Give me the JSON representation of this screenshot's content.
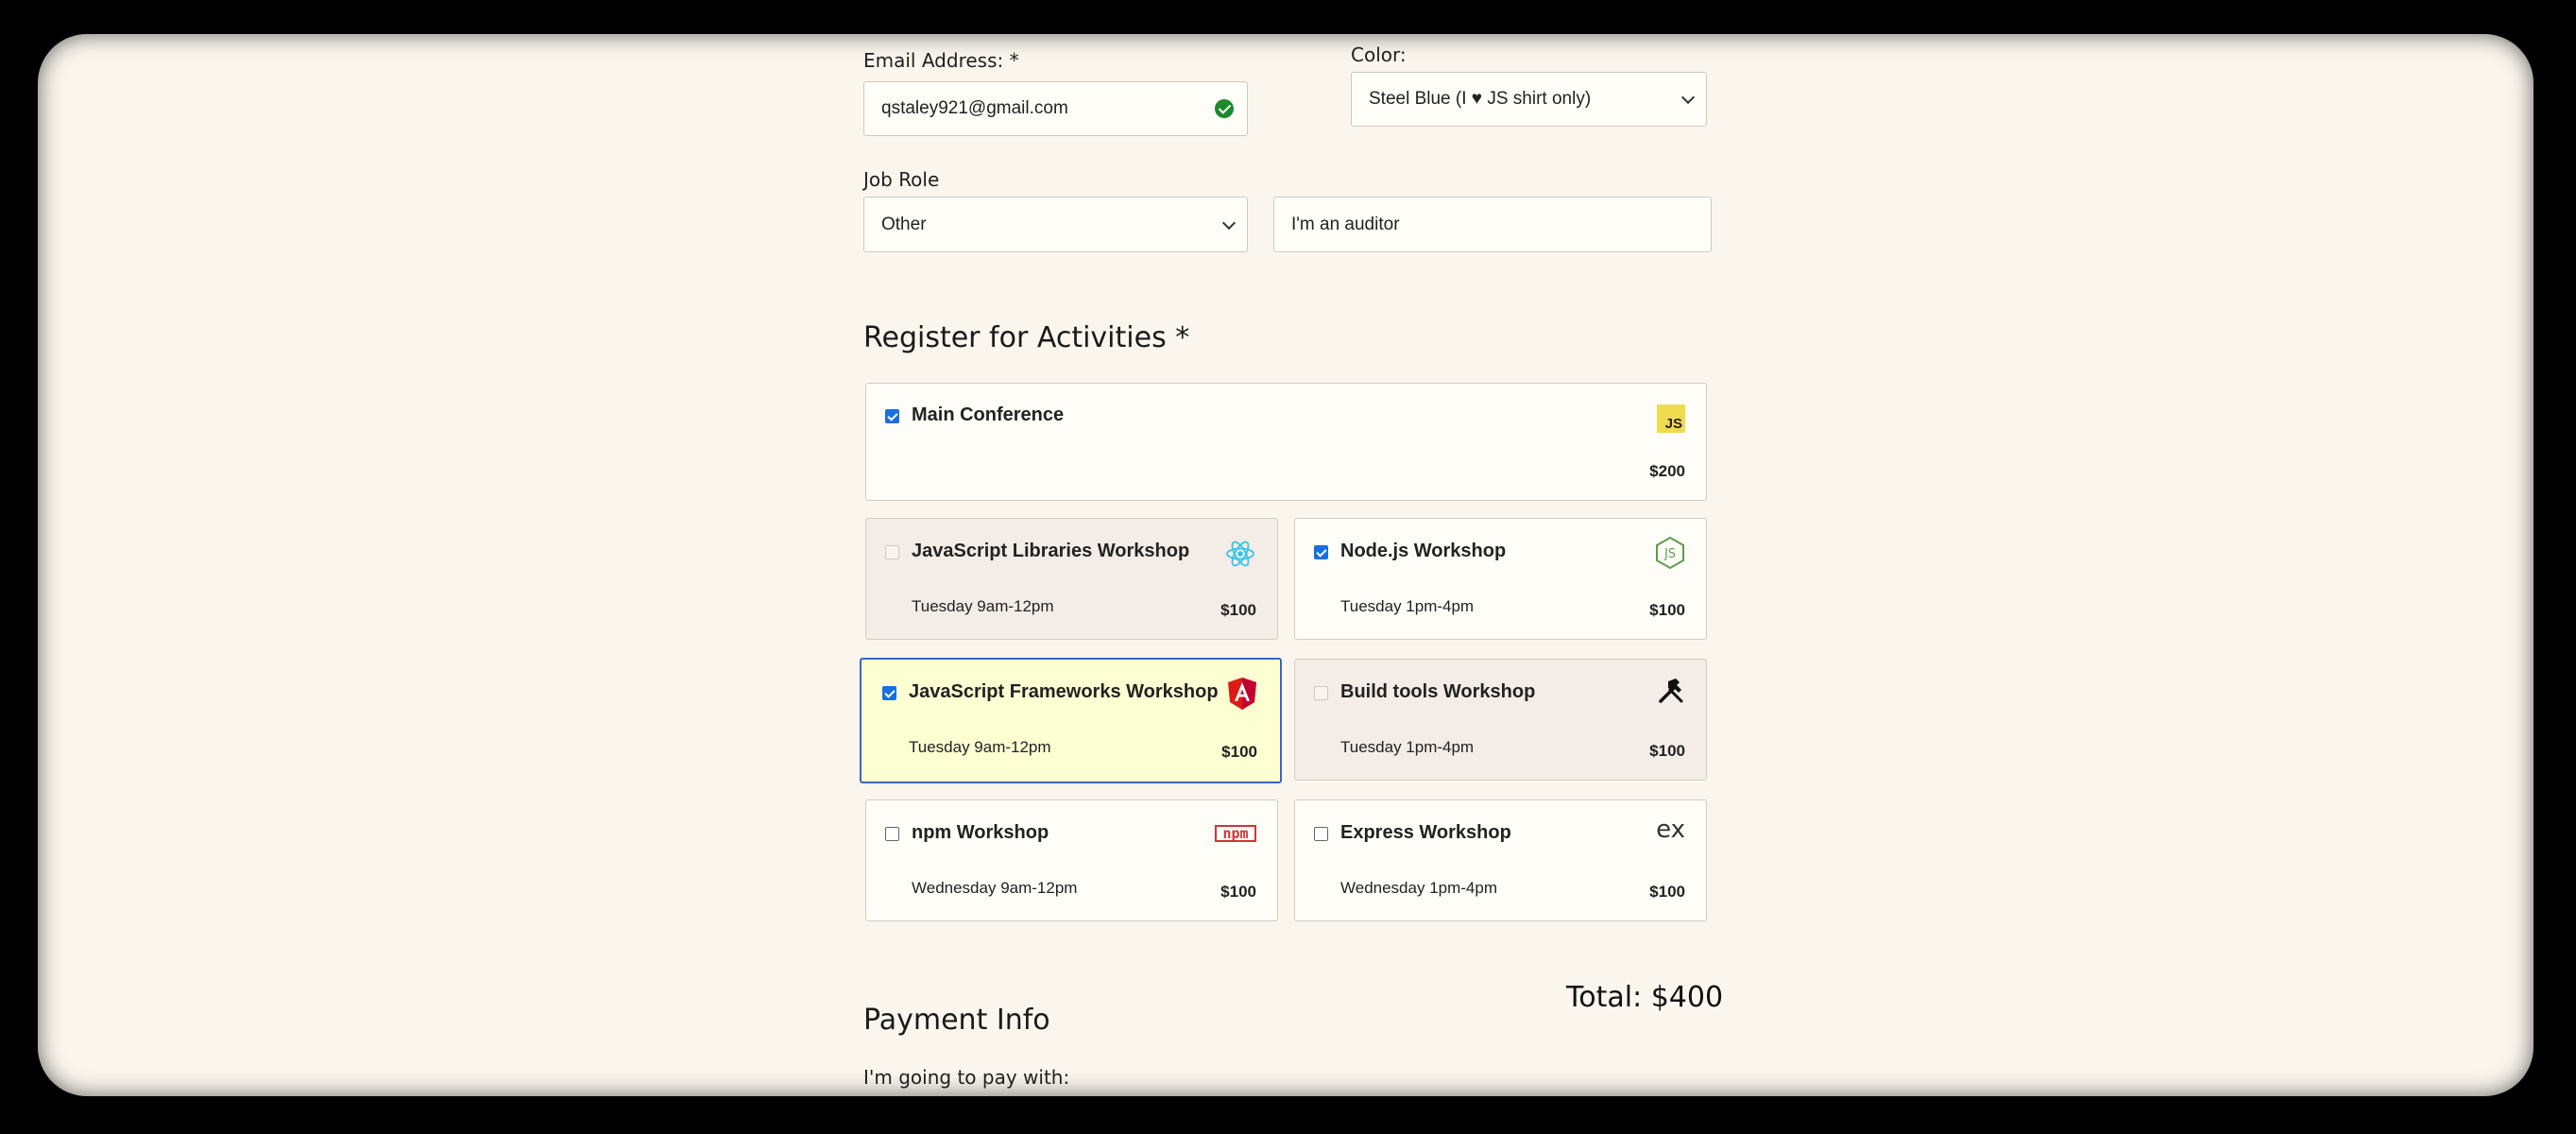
{
  "form": {
    "email": {
      "label": "Email Address:",
      "required_mark": "*",
      "value": "qstaley921@gmail.com"
    },
    "color": {
      "label": "Color:",
      "value": "Steel Blue (I ♥ JS shirt only)"
    },
    "job_role": {
      "label": "Job Role",
      "value": "Other",
      "other_value": "I'm an auditor"
    }
  },
  "activities": {
    "heading": "Register for Activities",
    "required_mark": "*",
    "items": [
      {
        "title": "Main Conference",
        "time": "",
        "price": "$200",
        "checked": true,
        "icon": "js-icon"
      },
      {
        "title": "JavaScript Libraries Workshop",
        "time": "Tuesday 9am-12pm",
        "price": "$100",
        "checked": false,
        "disabled": true,
        "icon": "react-icon"
      },
      {
        "title": "Node.js Workshop",
        "time": "Tuesday 1pm-4pm",
        "price": "$100",
        "checked": true,
        "icon": "nodejs-icon"
      },
      {
        "title": "JavaScript Frameworks Workshop",
        "time": "Tuesday 9am-12pm",
        "price": "$100",
        "checked": true,
        "focused": true,
        "icon": "angular-icon"
      },
      {
        "title": "Build tools Workshop",
        "time": "Tuesday 1pm-4pm",
        "price": "$100",
        "checked": false,
        "disabled": true,
        "icon": "tools-icon"
      },
      {
        "title": "npm Workshop",
        "time": "Wednesday 9am-12pm",
        "price": "$100",
        "checked": false,
        "icon": "npm-icon"
      },
      {
        "title": "Express Workshop",
        "time": "Wednesday 1pm-4pm",
        "price": "$100",
        "checked": false,
        "icon": "express-icon"
      }
    ],
    "total": "Total: $400"
  },
  "payment": {
    "heading": "Payment Info",
    "pay_with_label": "I'm going to pay with:"
  },
  "icons": {
    "js_text": "JS",
    "npm_text": "npm",
    "express_text": "ex"
  },
  "colors": {
    "background": "#faf6ee",
    "checkbox_checked": "#1a6fe0",
    "focus_border": "#3b63c9",
    "focus_bg": "#fbffd2",
    "valid_green": "#1d8a2c"
  }
}
